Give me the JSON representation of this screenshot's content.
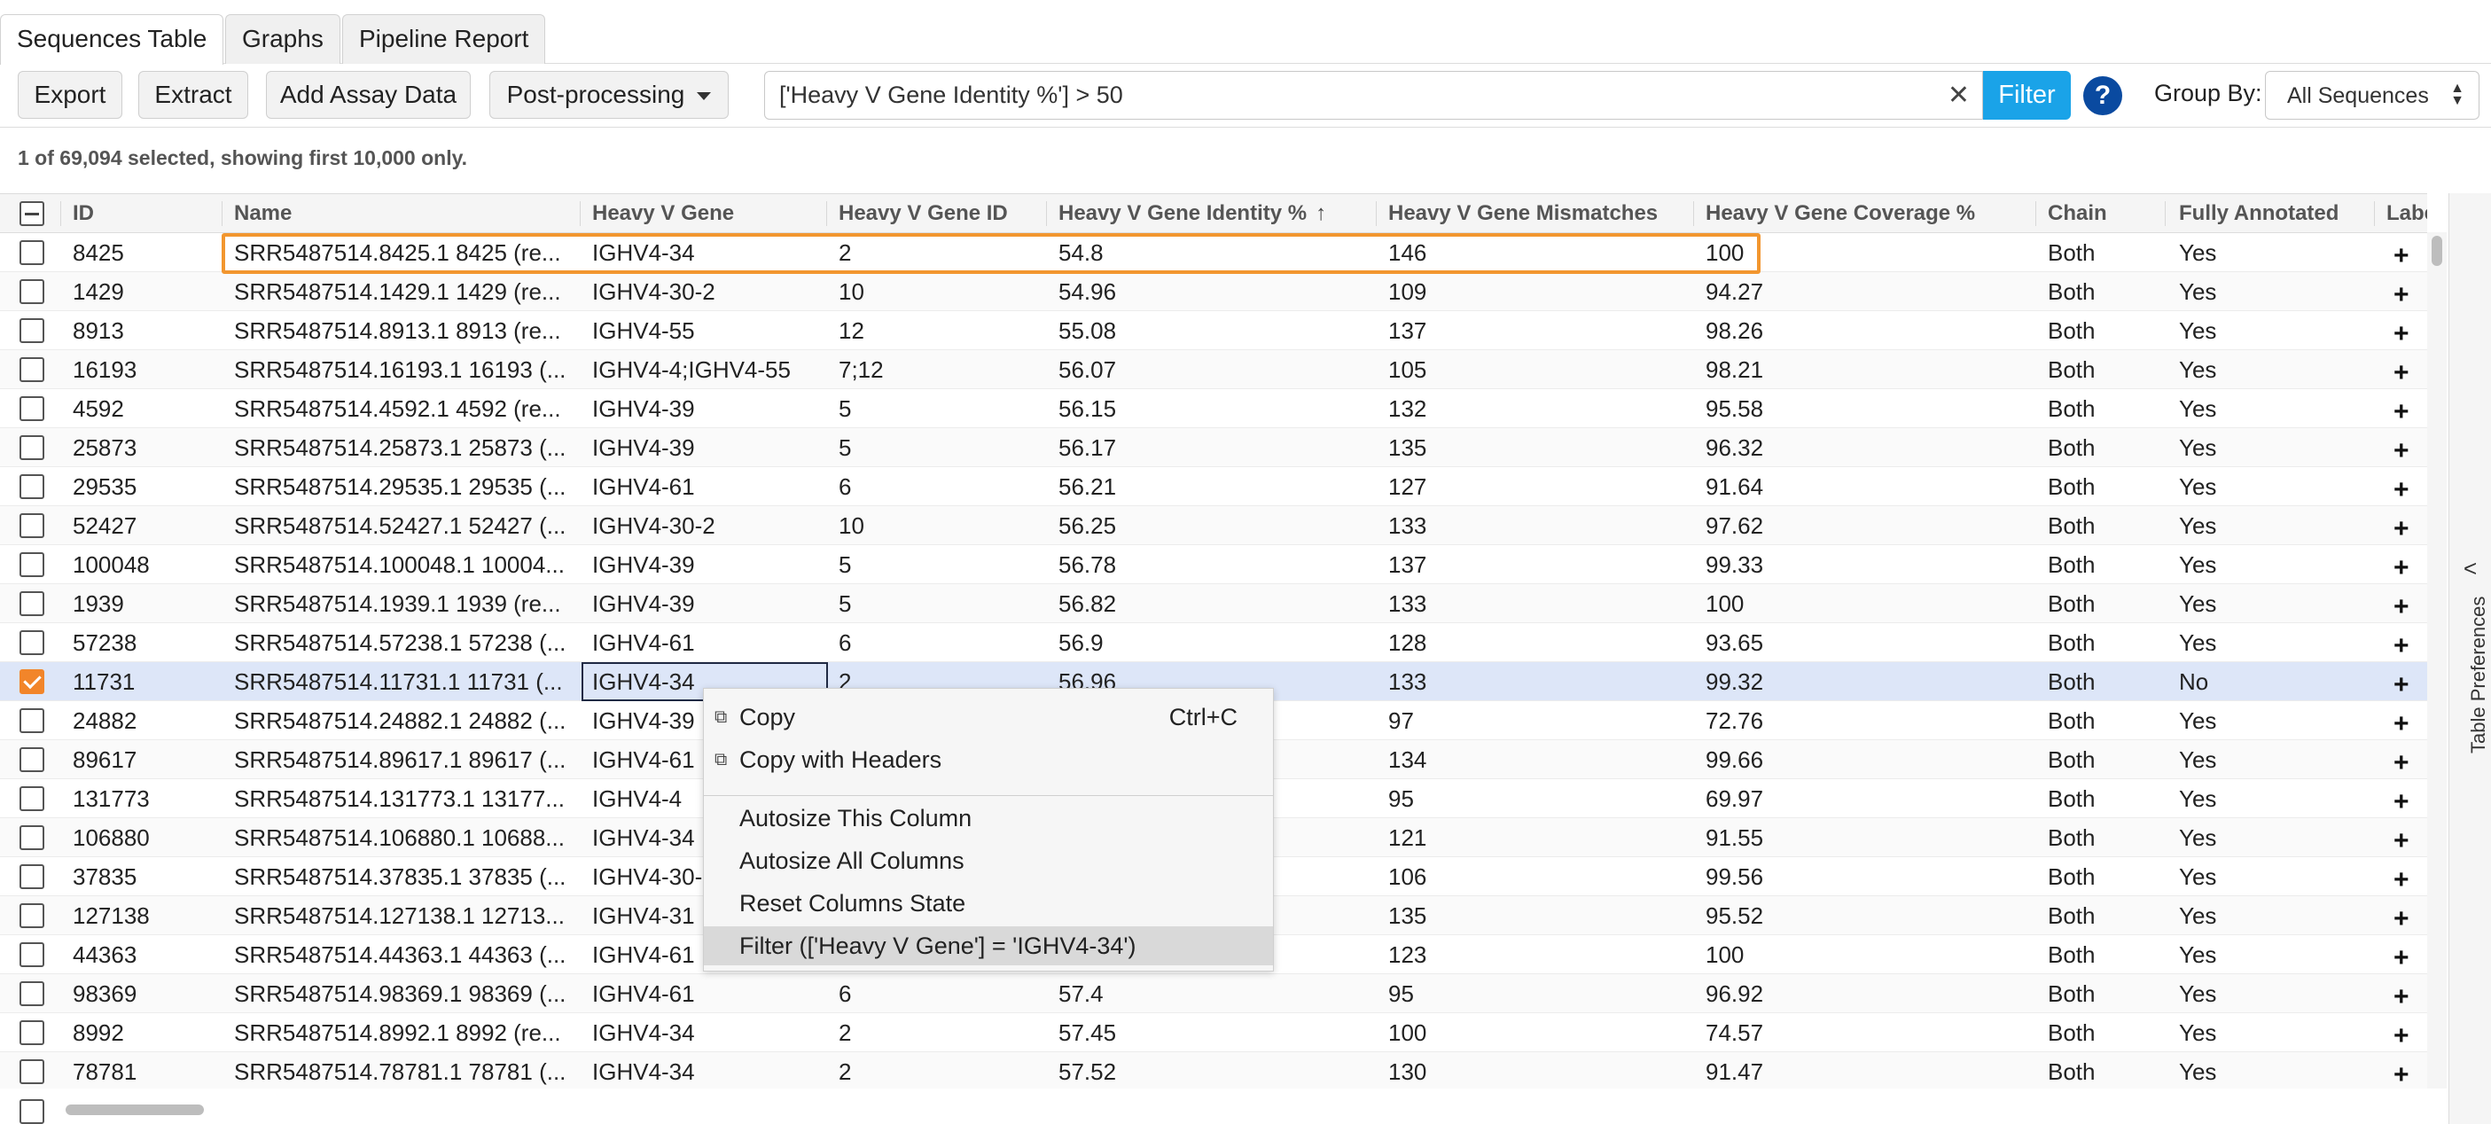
{
  "tabs": [
    "Sequences Table",
    "Graphs",
    "Pipeline Report"
  ],
  "toolbar": {
    "export": "Export",
    "extract": "Extract",
    "add_assay": "Add Assay Data",
    "post_processing": "Post-processing",
    "search_value": "['Heavy V Gene Identity %'] > 50",
    "filter": "Filter",
    "help": "?",
    "group_by_label": "Group By:",
    "group_by_value": "All Sequences"
  },
  "selection_info": "1 of 69,094 selected, showing first 10,000 only.",
  "columns": [
    "ID",
    "Name",
    "Heavy V Gene",
    "Heavy V Gene ID",
    "Heavy V Gene Identity %",
    "Heavy V Gene Mismatches",
    "Heavy V Gene Coverage %",
    "Chain",
    "Fully Annotated",
    "Labels"
  ],
  "sort_icon": "↑",
  "rows": [
    {
      "id": "8425",
      "name": "SRR5487514.8425.1 8425 (re...",
      "vgene": "IGHV4-34",
      "vgeneid": "2",
      "identity": "54.8",
      "mismatches": "146",
      "coverage": "100",
      "chain": "Both",
      "annotated": "Yes",
      "checked": false
    },
    {
      "id": "1429",
      "name": "SRR5487514.1429.1 1429 (re...",
      "vgene": "IGHV4-30-2",
      "vgeneid": "10",
      "identity": "54.96",
      "mismatches": "109",
      "coverage": "94.27",
      "chain": "Both",
      "annotated": "Yes",
      "checked": false
    },
    {
      "id": "8913",
      "name": "SRR5487514.8913.1 8913 (re...",
      "vgene": "IGHV4-55",
      "vgeneid": "12",
      "identity": "55.08",
      "mismatches": "137",
      "coverage": "98.26",
      "chain": "Both",
      "annotated": "Yes",
      "checked": false
    },
    {
      "id": "16193",
      "name": "SRR5487514.16193.1 16193 (...",
      "vgene": "IGHV4-4;IGHV4-55",
      "vgeneid": "7;12",
      "identity": "56.07",
      "mismatches": "105",
      "coverage": "98.21",
      "chain": "Both",
      "annotated": "Yes",
      "checked": false
    },
    {
      "id": "4592",
      "name": "SRR5487514.4592.1 4592 (re...",
      "vgene": "IGHV4-39",
      "vgeneid": "5",
      "identity": "56.15",
      "mismatches": "132",
      "coverage": "95.58",
      "chain": "Both",
      "annotated": "Yes",
      "checked": false
    },
    {
      "id": "25873",
      "name": "SRR5487514.25873.1 25873 (...",
      "vgene": "IGHV4-39",
      "vgeneid": "5",
      "identity": "56.17",
      "mismatches": "135",
      "coverage": "96.32",
      "chain": "Both",
      "annotated": "Yes",
      "checked": false
    },
    {
      "id": "29535",
      "name": "SRR5487514.29535.1 29535 (...",
      "vgene": "IGHV4-61",
      "vgeneid": "6",
      "identity": "56.21",
      "mismatches": "127",
      "coverage": "91.64",
      "chain": "Both",
      "annotated": "Yes",
      "checked": false
    },
    {
      "id": "52427",
      "name": "SRR5487514.52427.1 52427 (...",
      "vgene": "IGHV4-30-2",
      "vgeneid": "10",
      "identity": "56.25",
      "mismatches": "133",
      "coverage": "97.62",
      "chain": "Both",
      "annotated": "Yes",
      "checked": false
    },
    {
      "id": "100048",
      "name": "SRR5487514.100048.1 10004...",
      "vgene": "IGHV4-39",
      "vgeneid": "5",
      "identity": "56.78",
      "mismatches": "137",
      "coverage": "99.33",
      "chain": "Both",
      "annotated": "Yes",
      "checked": false
    },
    {
      "id": "1939",
      "name": "SRR5487514.1939.1 1939 (re...",
      "vgene": "IGHV4-39",
      "vgeneid": "5",
      "identity": "56.82",
      "mismatches": "133",
      "coverage": "100",
      "chain": "Both",
      "annotated": "Yes",
      "checked": false
    },
    {
      "id": "57238",
      "name": "SRR5487514.57238.1 57238 (...",
      "vgene": "IGHV4-61",
      "vgeneid": "6",
      "identity": "56.9",
      "mismatches": "128",
      "coverage": "93.65",
      "chain": "Both",
      "annotated": "Yes",
      "checked": false
    },
    {
      "id": "11731",
      "name": "SRR5487514.11731.1 11731 (...",
      "vgene": "IGHV4-34",
      "vgeneid": "2",
      "identity": "56.96",
      "mismatches": "133",
      "coverage": "99.32",
      "chain": "Both",
      "annotated": "No",
      "checked": true
    },
    {
      "id": "24882",
      "name": "SRR5487514.24882.1 24882 (...",
      "vgene": "IGHV4-39",
      "vgeneid": "",
      "identity": "",
      "mismatches": "97",
      "coverage": "72.76",
      "chain": "Both",
      "annotated": "Yes",
      "checked": false
    },
    {
      "id": "89617",
      "name": "SRR5487514.89617.1 89617 (...",
      "vgene": "IGHV4-61",
      "vgeneid": "",
      "identity": "",
      "mismatches": "134",
      "coverage": "99.66",
      "chain": "Both",
      "annotated": "Yes",
      "checked": false
    },
    {
      "id": "131773",
      "name": "SRR5487514.131773.1 13177...",
      "vgene": "IGHV4-4",
      "vgeneid": "",
      "identity": "",
      "mismatches": "95",
      "coverage": "69.97",
      "chain": "Both",
      "annotated": "Yes",
      "checked": false
    },
    {
      "id": "106880",
      "name": "SRR5487514.106880.1 10688...",
      "vgene": "IGHV4-34",
      "vgeneid": "",
      "identity": "",
      "mismatches": "121",
      "coverage": "91.55",
      "chain": "Both",
      "annotated": "Yes",
      "checked": false
    },
    {
      "id": "37835",
      "name": "SRR5487514.37835.1 37835 (...",
      "vgene": "IGHV4-30-",
      "vgeneid": "",
      "identity": "",
      "mismatches": "106",
      "coverage": "99.56",
      "chain": "Both",
      "annotated": "Yes",
      "checked": false
    },
    {
      "id": "127138",
      "name": "SRR5487514.127138.1 12713...",
      "vgene": "IGHV4-31",
      "vgeneid": "",
      "identity": "",
      "mismatches": "135",
      "coverage": "95.52",
      "chain": "Both",
      "annotated": "Yes",
      "checked": false
    },
    {
      "id": "44363",
      "name": "SRR5487514.44363.1 44363 (...",
      "vgene": "IGHV4-61",
      "vgeneid": "",
      "identity": "",
      "mismatches": "123",
      "coverage": "100",
      "chain": "Both",
      "annotated": "Yes",
      "checked": false
    },
    {
      "id": "98369",
      "name": "SRR5487514.98369.1 98369 (...",
      "vgene": "IGHV4-61",
      "vgeneid": "6",
      "identity": "57.4",
      "mismatches": "95",
      "coverage": "96.92",
      "chain": "Both",
      "annotated": "Yes",
      "checked": false
    },
    {
      "id": "8992",
      "name": "SRR5487514.8992.1 8992 (re...",
      "vgene": "IGHV4-34",
      "vgeneid": "2",
      "identity": "57.45",
      "mismatches": "100",
      "coverage": "74.57",
      "chain": "Both",
      "annotated": "Yes",
      "checked": false
    },
    {
      "id": "78781",
      "name": "SRR5487514.78781.1 78781 (...",
      "vgene": "IGHV4-34",
      "vgeneid": "2",
      "identity": "57.52",
      "mismatches": "130",
      "coverage": "91.47",
      "chain": "Both",
      "annotated": "Yes",
      "checked": false
    }
  ],
  "row_action_icon": "+",
  "context_menu": {
    "copy": "Copy",
    "copy_shortcut": "Ctrl+C",
    "copy_with_headers": "Copy with Headers",
    "autosize_this": "Autosize This Column",
    "autosize_all": "Autosize All Columns",
    "reset_columns": "Reset Columns State",
    "filter_by": "Filter (['Heavy V Gene'] = 'IGHV4-34')"
  },
  "side_panel": {
    "label": "Table Preferences",
    "chevron": "<"
  },
  "colors": {
    "accent": "#1aa3e8",
    "highlight": "#f2962f",
    "selected_row": "#dde6f8",
    "checkbox_checked": "#f2852a"
  }
}
